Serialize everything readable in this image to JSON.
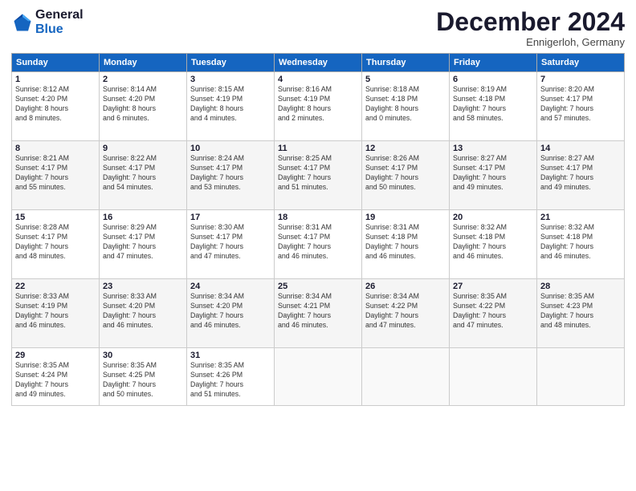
{
  "header": {
    "logo_line1": "General",
    "logo_line2": "Blue",
    "month": "December 2024",
    "location": "Ennigerloh, Germany"
  },
  "days_of_week": [
    "Sunday",
    "Monday",
    "Tuesday",
    "Wednesday",
    "Thursday",
    "Friday",
    "Saturday"
  ],
  "weeks": [
    [
      {
        "day": "1",
        "detail": "Sunrise: 8:12 AM\nSunset: 4:20 PM\nDaylight: 8 hours\nand 8 minutes."
      },
      {
        "day": "2",
        "detail": "Sunrise: 8:14 AM\nSunset: 4:20 PM\nDaylight: 8 hours\nand 6 minutes."
      },
      {
        "day": "3",
        "detail": "Sunrise: 8:15 AM\nSunset: 4:19 PM\nDaylight: 8 hours\nand 4 minutes."
      },
      {
        "day": "4",
        "detail": "Sunrise: 8:16 AM\nSunset: 4:19 PM\nDaylight: 8 hours\nand 2 minutes."
      },
      {
        "day": "5",
        "detail": "Sunrise: 8:18 AM\nSunset: 4:18 PM\nDaylight: 8 hours\nand 0 minutes."
      },
      {
        "day": "6",
        "detail": "Sunrise: 8:19 AM\nSunset: 4:18 PM\nDaylight: 7 hours\nand 58 minutes."
      },
      {
        "day": "7",
        "detail": "Sunrise: 8:20 AM\nSunset: 4:17 PM\nDaylight: 7 hours\nand 57 minutes."
      }
    ],
    [
      {
        "day": "8",
        "detail": "Sunrise: 8:21 AM\nSunset: 4:17 PM\nDaylight: 7 hours\nand 55 minutes."
      },
      {
        "day": "9",
        "detail": "Sunrise: 8:22 AM\nSunset: 4:17 PM\nDaylight: 7 hours\nand 54 minutes."
      },
      {
        "day": "10",
        "detail": "Sunrise: 8:24 AM\nSunset: 4:17 PM\nDaylight: 7 hours\nand 53 minutes."
      },
      {
        "day": "11",
        "detail": "Sunrise: 8:25 AM\nSunset: 4:17 PM\nDaylight: 7 hours\nand 51 minutes."
      },
      {
        "day": "12",
        "detail": "Sunrise: 8:26 AM\nSunset: 4:17 PM\nDaylight: 7 hours\nand 50 minutes."
      },
      {
        "day": "13",
        "detail": "Sunrise: 8:27 AM\nSunset: 4:17 PM\nDaylight: 7 hours\nand 49 minutes."
      },
      {
        "day": "14",
        "detail": "Sunrise: 8:27 AM\nSunset: 4:17 PM\nDaylight: 7 hours\nand 49 minutes."
      }
    ],
    [
      {
        "day": "15",
        "detail": "Sunrise: 8:28 AM\nSunset: 4:17 PM\nDaylight: 7 hours\nand 48 minutes."
      },
      {
        "day": "16",
        "detail": "Sunrise: 8:29 AM\nSunset: 4:17 PM\nDaylight: 7 hours\nand 47 minutes."
      },
      {
        "day": "17",
        "detail": "Sunrise: 8:30 AM\nSunset: 4:17 PM\nDaylight: 7 hours\nand 47 minutes."
      },
      {
        "day": "18",
        "detail": "Sunrise: 8:31 AM\nSunset: 4:17 PM\nDaylight: 7 hours\nand 46 minutes."
      },
      {
        "day": "19",
        "detail": "Sunrise: 8:31 AM\nSunset: 4:18 PM\nDaylight: 7 hours\nand 46 minutes."
      },
      {
        "day": "20",
        "detail": "Sunrise: 8:32 AM\nSunset: 4:18 PM\nDaylight: 7 hours\nand 46 minutes."
      },
      {
        "day": "21",
        "detail": "Sunrise: 8:32 AM\nSunset: 4:18 PM\nDaylight: 7 hours\nand 46 minutes."
      }
    ],
    [
      {
        "day": "22",
        "detail": "Sunrise: 8:33 AM\nSunset: 4:19 PM\nDaylight: 7 hours\nand 46 minutes."
      },
      {
        "day": "23",
        "detail": "Sunrise: 8:33 AM\nSunset: 4:20 PM\nDaylight: 7 hours\nand 46 minutes."
      },
      {
        "day": "24",
        "detail": "Sunrise: 8:34 AM\nSunset: 4:20 PM\nDaylight: 7 hours\nand 46 minutes."
      },
      {
        "day": "25",
        "detail": "Sunrise: 8:34 AM\nSunset: 4:21 PM\nDaylight: 7 hours\nand 46 minutes."
      },
      {
        "day": "26",
        "detail": "Sunrise: 8:34 AM\nSunset: 4:22 PM\nDaylight: 7 hours\nand 47 minutes."
      },
      {
        "day": "27",
        "detail": "Sunrise: 8:35 AM\nSunset: 4:22 PM\nDaylight: 7 hours\nand 47 minutes."
      },
      {
        "day": "28",
        "detail": "Sunrise: 8:35 AM\nSunset: 4:23 PM\nDaylight: 7 hours\nand 48 minutes."
      }
    ],
    [
      {
        "day": "29",
        "detail": "Sunrise: 8:35 AM\nSunset: 4:24 PM\nDaylight: 7 hours\nand 49 minutes."
      },
      {
        "day": "30",
        "detail": "Sunrise: 8:35 AM\nSunset: 4:25 PM\nDaylight: 7 hours\nand 50 minutes."
      },
      {
        "day": "31",
        "detail": "Sunrise: 8:35 AM\nSunset: 4:26 PM\nDaylight: 7 hours\nand 51 minutes."
      },
      {
        "day": "",
        "detail": ""
      },
      {
        "day": "",
        "detail": ""
      },
      {
        "day": "",
        "detail": ""
      },
      {
        "day": "",
        "detail": ""
      }
    ]
  ]
}
